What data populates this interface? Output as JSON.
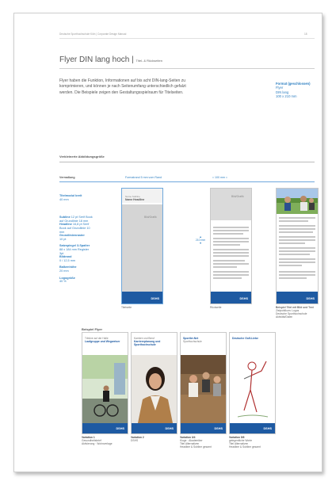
{
  "header": {
    "running_title": "Deutsche Sporthochschule Köln | Corporate Design Manual",
    "page_number": "18"
  },
  "title": {
    "main": "Flyer DIN lang hoch |",
    "sub": "Titel- & Rückseiten"
  },
  "intro": "Flyer haben die Funktion, Informationen auf bis acht DIN-lang-Seiten zu komprimieren, und können je nach Seitenumfang unterschiedlich gefalzt werden. Die Beispiele zeigen den Gestaltungsspielraum für Titelseiten.",
  "format": {
    "label": "Format (geschlossen)",
    "lines": [
      "Flyer",
      "DIN lang",
      "100 x 210 mm"
    ]
  },
  "scaled_section": {
    "heading": "Verkleinerte Abbildungsgröße",
    "col_label": "Vermaßung",
    "satzspiegel_label": "Formatrand",
    "satzspiegel_value": "5 mm vom Rand",
    "satzspiegel_width": "≈ 100 mm ≈",
    "specs": [
      {
        "label": "Titelmodul breit",
        "value": "40 mm"
      },
      {
        "label": "Subline",
        "value": "12 pt Serif Book auf Grundlinie 18 mm"
      },
      {
        "label": "Headline",
        "value": "16,8 pt Serif Book auf Grundlinie 10 mm"
      },
      {
        "label": "Grundlinienraster",
        "value": "10 pt"
      },
      {
        "label": "Satzspiegel 3-Spalter",
        "value": "88 x 184 mm Register 3pt"
      },
      {
        "label": "Bildrand",
        "value": "0 / 12,5 mm"
      },
      {
        "label": "Balkenhöhe",
        "value": "20 mm"
      },
      {
        "label": "Logogröße",
        "value": "40 %"
      }
    ],
    "mock_title": {
      "line1": "Name Subline",
      "line2": "Name Headline"
    },
    "bild_label": "Bild/Grafik",
    "titel_label": "Bild/Grafik",
    "captions": [
      "Titelseite",
      "Rückseite"
    ],
    "measure_label": "210 mm",
    "example_caption": {
      "title": "Beispiel Titel mit Bild und Text",
      "lines": [
        "Zielpublikum: Logos",
        "Deutsche Sporthochschule",
        "Aktivität/Daten"
      ]
    },
    "logo": "DSHS"
  },
  "flyer_section": {
    "heading": "Beispiel Flyer",
    "logo": "DSHS",
    "flyers": [
      {
        "head_small": "Tribüne auf der Halle",
        "head_title": "Laufgruppe und Wegweiser",
        "cap_title": "Variation 1",
        "cap_lines": [
          "Gesundheitsbrief",
          "Aktivierung · Wohnverlage"
        ]
      },
      {
        "head_small": "Karriere und Beruf",
        "head_title": "Karriereplanung und Sporthochschule",
        "cap_title": "Variation 2",
        "cap_lines": [
          "DSHS"
        ]
      },
      {
        "head_small": "Sporthochschule",
        "head_title": "Sportler.Net",
        "cap_title": "Variation 3/4",
        "cap_lines": [
          "Kluge · Akademiker",
          "Titel Alternativen",
          "Headline & Subline gesamt"
        ]
      },
      {
        "head_small": "Deutsche Golf-Liebe",
        "head_title": "",
        "cap_title": "Variation 5/6",
        "cap_lines": [
          "gelegentliche Worte",
          "Titel Alternativen",
          "Headline & Subline gesamt"
        ]
      }
    ]
  }
}
